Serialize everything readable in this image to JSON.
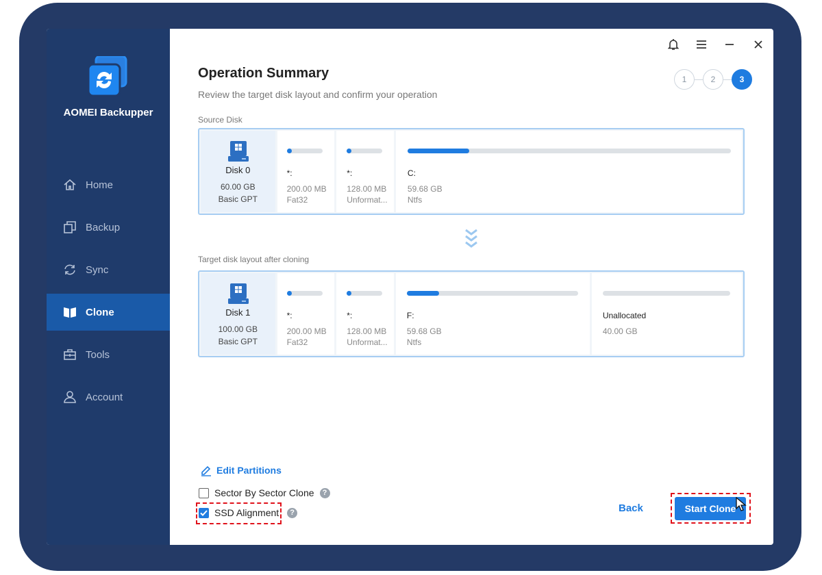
{
  "app": {
    "name": "AOMEI Backupper"
  },
  "sidebar": {
    "items": [
      {
        "label": "Home",
        "icon": "home-icon",
        "active": false
      },
      {
        "label": "Backup",
        "icon": "backup-icon",
        "active": false
      },
      {
        "label": "Sync",
        "icon": "sync-icon",
        "active": false
      },
      {
        "label": "Clone",
        "icon": "clone-icon",
        "active": true
      },
      {
        "label": "Tools",
        "icon": "tools-icon",
        "active": false
      },
      {
        "label": "Account",
        "icon": "account-icon",
        "active": false
      }
    ]
  },
  "window_controls": [
    "bell-icon",
    "menu-icon",
    "minimize-icon",
    "close-icon"
  ],
  "header": {
    "title": "Operation Summary",
    "subtitle": "Review the target disk layout and confirm your operation"
  },
  "steps": [
    {
      "label": "1",
      "active": false
    },
    {
      "label": "2",
      "active": false
    },
    {
      "label": "3",
      "active": true
    }
  ],
  "source": {
    "section_label": "Source Disk",
    "disk": {
      "name": "Disk 0",
      "size": "60.00 GB",
      "type": "Basic GPT"
    },
    "partitions": [
      {
        "label": "*:",
        "size": "200.00 MB",
        "fs": "Fat32",
        "used": 0.02
      },
      {
        "label": "*:",
        "size": "128.00 MB",
        "fs": "Unformat...",
        "used": 0.02
      },
      {
        "label": "C:",
        "size": "59.68 GB",
        "fs": "Ntfs",
        "used": 0.19
      }
    ]
  },
  "target": {
    "section_label": "Target disk layout after cloning",
    "disk": {
      "name": "Disk 1",
      "size": "100.00 GB",
      "type": "Basic GPT"
    },
    "partitions": [
      {
        "label": "*:",
        "size": "200.00 MB",
        "fs": "Fat32",
        "used": 0.02
      },
      {
        "label": "*:",
        "size": "128.00 MB",
        "fs": "Unformat...",
        "used": 0.02
      },
      {
        "label": "F:",
        "size": "59.68 GB",
        "fs": "Ntfs",
        "used": 0.19
      },
      {
        "label": "Unallocated",
        "size": "40.00 GB",
        "fs": "",
        "used": 0
      }
    ]
  },
  "options": {
    "edit_partitions": "Edit Partitions",
    "sector_by_sector": {
      "label": "Sector By Sector Clone",
      "checked": false
    },
    "ssd_alignment": {
      "label": "SSD Alignment",
      "checked": true
    },
    "help_glyph": "?"
  },
  "actions": {
    "back": "Back",
    "start": "Start Clone"
  },
  "colors": {
    "accent": "#1f7ce0",
    "sidebar": "#1f3b6b",
    "highlight": "#e0121b"
  }
}
